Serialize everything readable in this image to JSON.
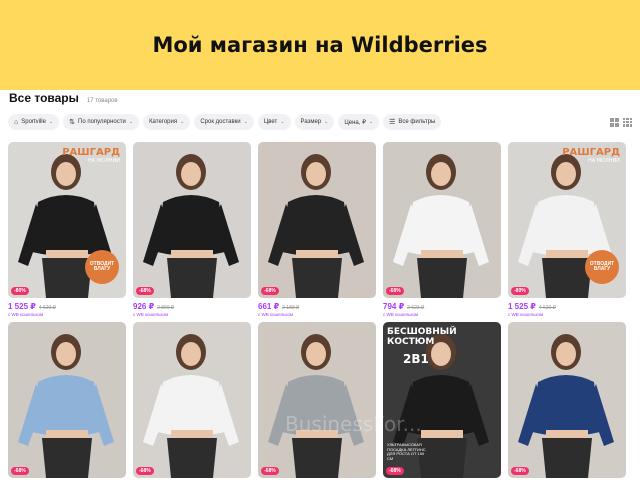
{
  "banner": {
    "title": "Мой магазин на Wildberries"
  },
  "page": {
    "title": "Все товары",
    "count": "17 товаров"
  },
  "filters": [
    {
      "label": "Sportville",
      "icon": "shop-icon"
    },
    {
      "label": "По популярности",
      "icon": "sort-icon"
    },
    {
      "label": "Категория"
    },
    {
      "label": "Срок доставки"
    },
    {
      "label": "Цвет"
    },
    {
      "label": "Размер"
    },
    {
      "label": "Цена, ₽"
    },
    {
      "label": "Все фильтры",
      "icon": "filter-icon"
    }
  ],
  "products": [
    {
      "discount": "-80%",
      "price": "1 525 ₽",
      "old": "4 620 ₽",
      "wallet": "с WB кошельком",
      "promo_title": "РАШГАРД",
      "promo_sub": "НА МОЛНИИ",
      "badge": "ОТВОДИТ ВЛАГУ",
      "color": "#1c1c1c",
      "bg": "#d9d7d4"
    },
    {
      "discount": "-68%",
      "price": "926 ₽",
      "old": "2 866 ₽",
      "wallet": "с WB кошельком",
      "color": "#1c1c1c",
      "bg": "#d4d1ce"
    },
    {
      "discount": "-68%",
      "price": "661 ₽",
      "old": "2 183 ₽",
      "wallet": "с WB кошельком",
      "color": "#232323",
      "bg": "#cfc6bf"
    },
    {
      "discount": "-68%",
      "price": "794 ₽",
      "old": "2 623 ₽",
      "wallet": "с WB кошельком",
      "color": "#f4f4f4",
      "bg": "#cfc9c4"
    },
    {
      "discount": "-80%",
      "price": "1 525 ₽",
      "old": "4 620 ₽",
      "wallet": "с WB кошельком",
      "promo_title": "РАШГАРД",
      "promo_sub": "НА МОЛНИИ",
      "badge": "ОТВОДИТ ВЛАГУ",
      "color": "#f2f2f2",
      "bg": "#d7d5d2"
    },
    {
      "discount": "-68%",
      "color": "#8fb2d9",
      "bg": "#cfc9c3"
    },
    {
      "discount": "-68%",
      "color": "#f3f3f3",
      "bg": "#d5d1cd"
    },
    {
      "discount": "-68%",
      "color": "#9ea3a8",
      "bg": "#cfc8c1"
    },
    {
      "discount": "-68%",
      "ad_top": "БЕСШОВНЫЙ КОСТЮМ",
      "ad_mid": "2В1",
      "ad_note": "УЛЬТРАВЫСОКАЯ ПОСАДКА ЛЕГГИНС ДЛЯ РОСТА ОТ 150 СМ",
      "color": "#1b1b1b",
      "bg": "#3a3a3a"
    },
    {
      "discount": "-68%",
      "color": "#233f7a",
      "bg": "#d2ccc6"
    }
  ],
  "watermark": "BusinessFor..."
}
